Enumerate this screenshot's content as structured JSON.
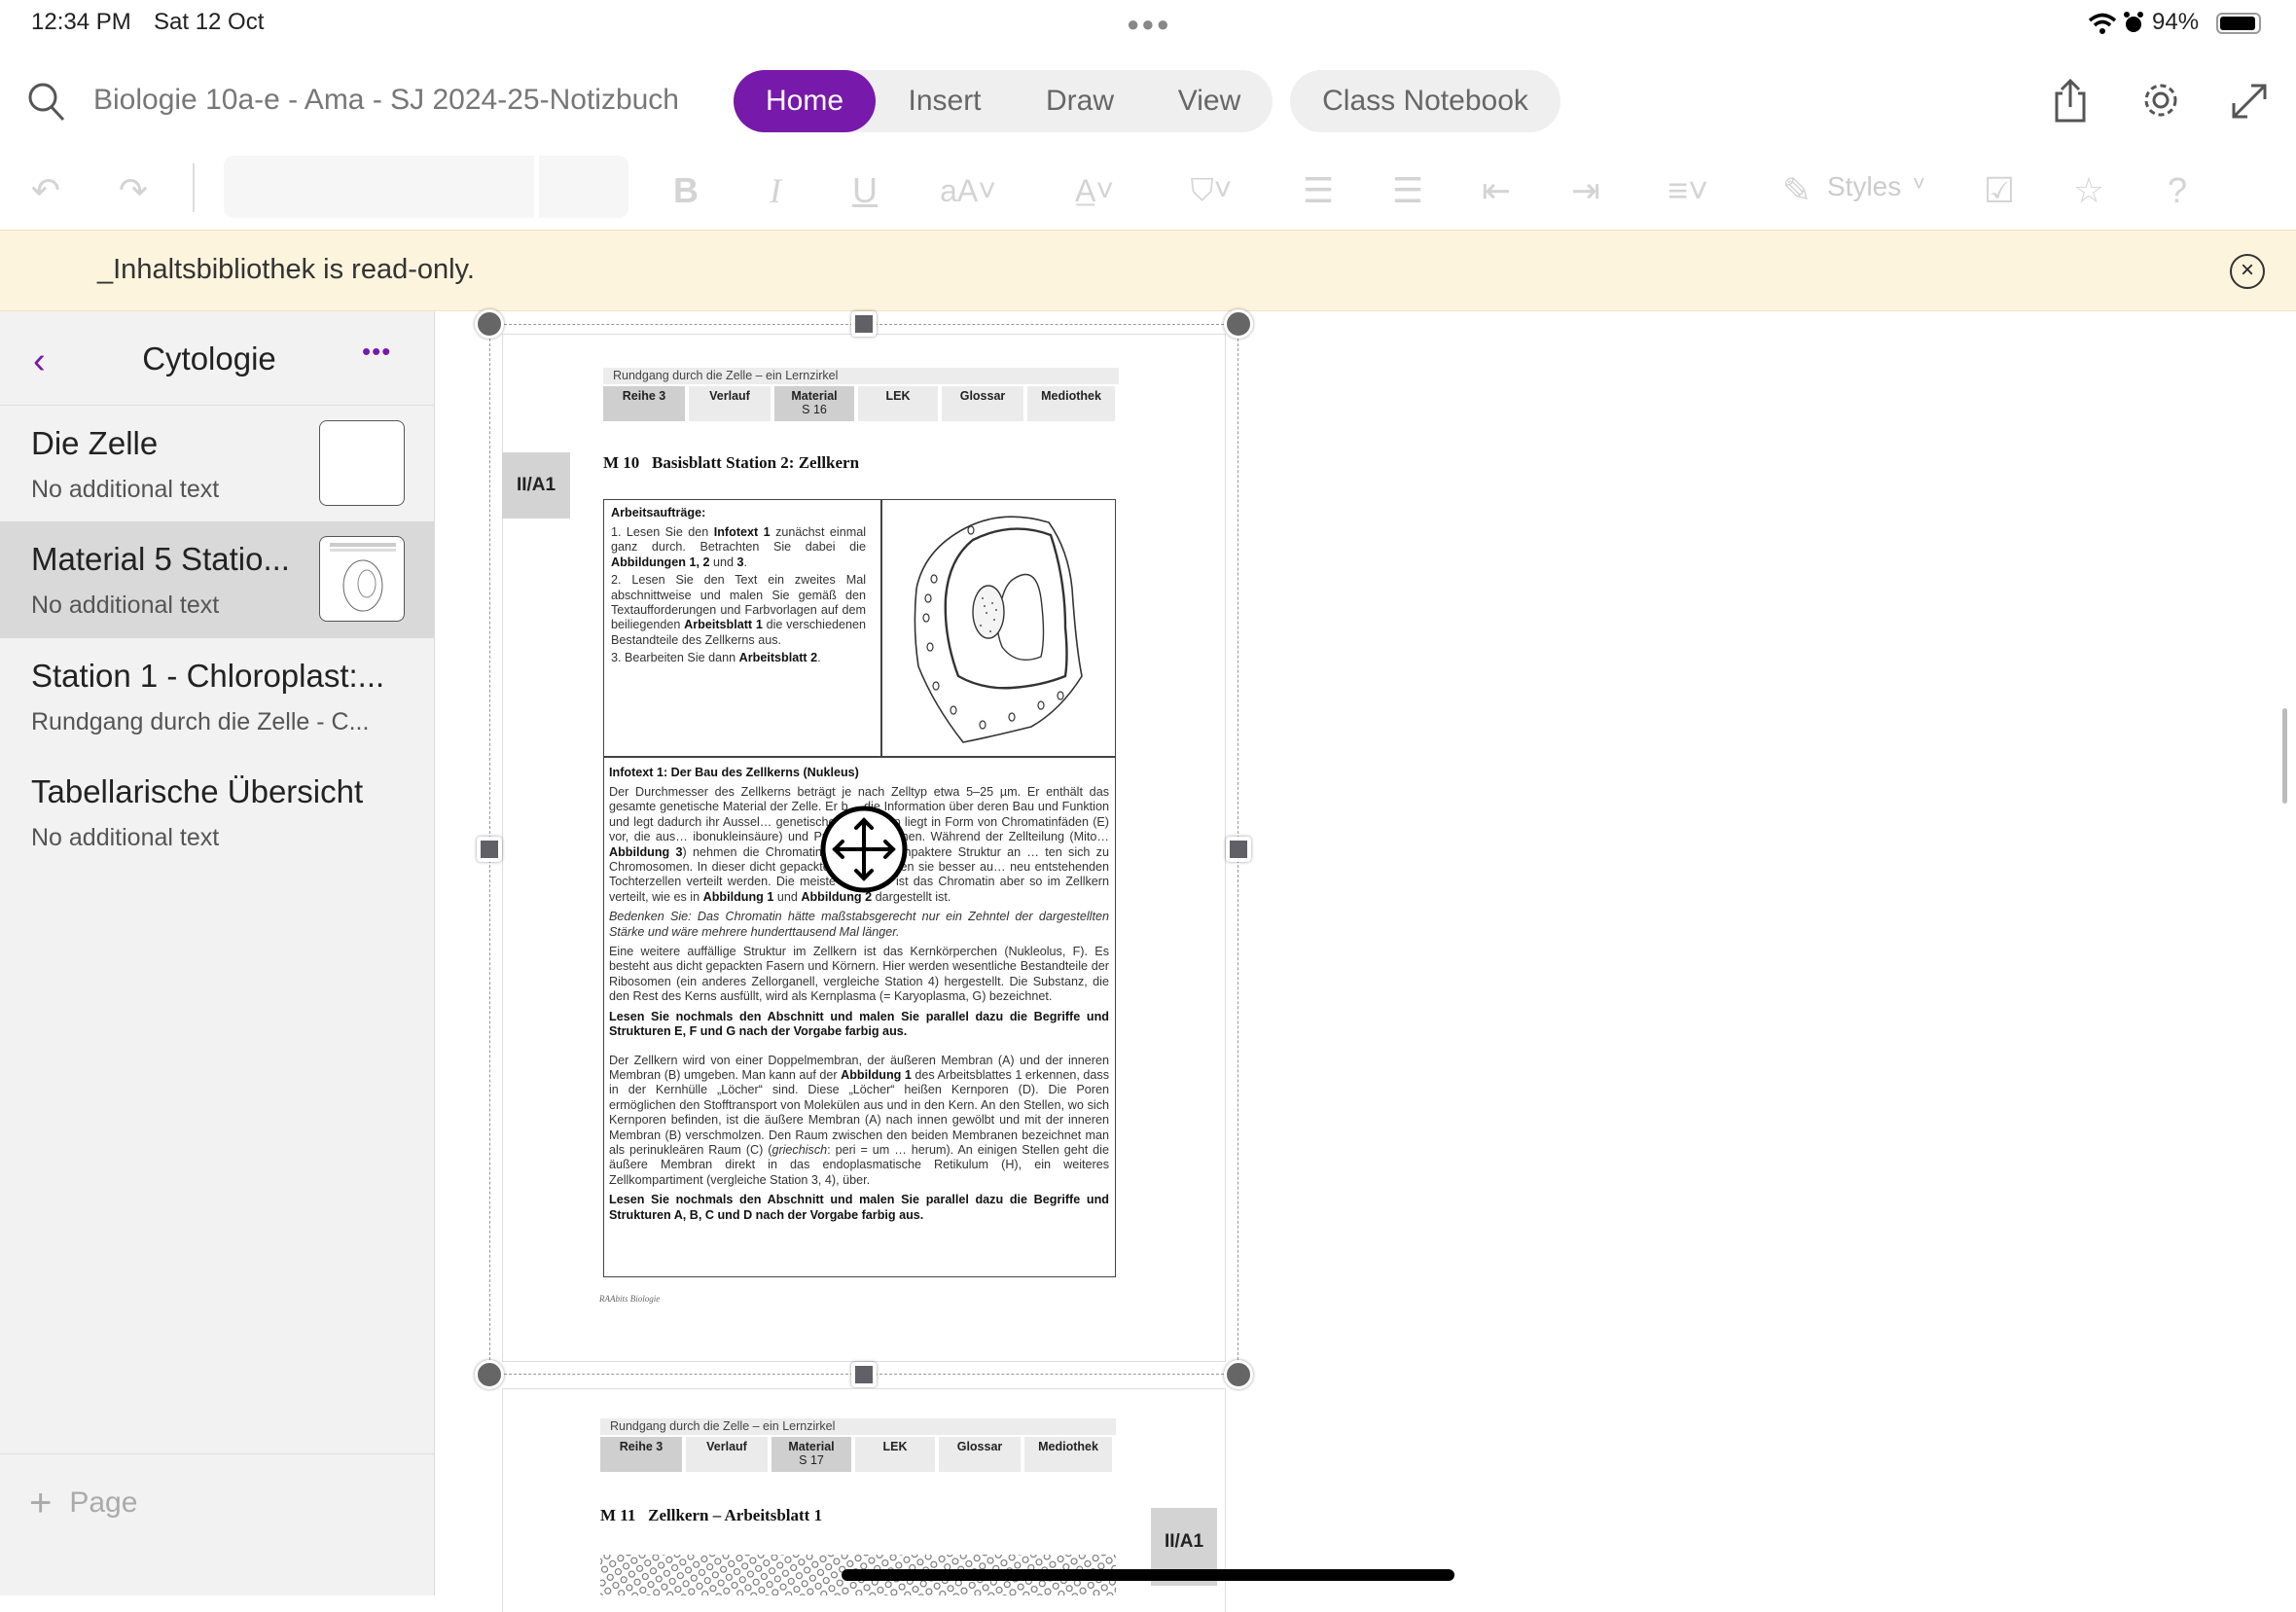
{
  "status_bar": {
    "time": "12:34 PM",
    "date": "Sat 12 Oct",
    "battery": "94%"
  },
  "header": {
    "notebook_title": "Biologie 10a-e - Ama - SJ 2024-25-Notizbuch",
    "tabs": [
      {
        "label": "Home",
        "active": true
      },
      {
        "label": "Insert"
      },
      {
        "label": "Draw"
      },
      {
        "label": "View"
      }
    ],
    "class_notebook": "Class Notebook",
    "accent_color": "#7719aa"
  },
  "toolbar": {
    "styles_label": "Styles"
  },
  "banner": {
    "message": "_Inhaltsbibliothek is read-only."
  },
  "sidebar": {
    "section_title": "Cytologie",
    "pages": [
      {
        "title": "Die Zelle",
        "subtitle": "No additional text"
      },
      {
        "title": "Material 5 Statio...",
        "subtitle": "No additional text",
        "selected": true
      },
      {
        "title": "Station 1 - Chloroplast:...",
        "subtitle": "Rundgang durch die Zelle - C..."
      },
      {
        "title": "Tabellarische Übersicht",
        "subtitle": "No additional text"
      }
    ],
    "add_page": "Page"
  },
  "document": {
    "page1": {
      "header": "Rundgang durch die Zelle – ein Lernzirkel",
      "tabs": [
        {
          "label": "Reihe 3"
        },
        {
          "label": "Verlauf"
        },
        {
          "label": "Material",
          "sub": "S 16"
        },
        {
          "label": "LEK"
        },
        {
          "label": "Glossar"
        },
        {
          "label": "Mediothek"
        }
      ],
      "margin_label": "II/A1",
      "title_num": "M 10",
      "title": "Basisblatt Station 2: Zellkern",
      "tasks_heading": "Arbeitsaufträge:",
      "tasks": [
        [
          {
            "t": "1. Lesen Sie den "
          },
          {
            "t": "Infotext 1",
            "b": true
          },
          {
            "t": " zunächst einmal ganz durch. Betrachten Sie dabei die "
          },
          {
            "t": "Abbildungen 1, 2",
            "b": true
          },
          {
            "t": " und "
          },
          {
            "t": "3",
            "b": true
          },
          {
            "t": "."
          }
        ],
        [
          {
            "t": "2. Lesen Sie den Text ein zweites Mal abschnittweise und malen Sie gemäß den Textaufforderungen und Farbvorlagen auf dem beiliegenden "
          },
          {
            "t": "Arbeitsblatt 1",
            "b": true
          },
          {
            "t": " die verschiedenen Bestandteile des Zellkerns aus."
          }
        ],
        [
          {
            "t": "3. Bearbeiten Sie dann "
          },
          {
            "t": "Arbeitsblatt 2",
            "b": true
          },
          {
            "t": "."
          }
        ]
      ],
      "infotext_heading": "Infotext 1: Der Bau des Zellkerns (Nukleus)",
      "paragraphs": [
        [
          {
            "t": "Der Durchmesser des Zellkerns beträgt je nach Zelltyp etwa 5–25 µm. Er enthält das gesamte genetische Material der Zelle. Er b… die Information über deren Bau und Funktion und legt dadurch ihr Aussel… genetische Information liegt in Form von Chromatinfäden (E) vor, die aus… ibonukleinsäure) und Proteinen bestehen. Während der Zellteilung (Mito… "
          },
          {
            "t": "Abbildung 3",
            "b": true
          },
          {
            "t": ") nehmen die Chromatinfäden eine kompaktere Struktur an … ten sich zu Chromosomen. In dieser dicht gepackten Form können sie besser au… neu entstehenden Tochterzellen verteilt werden. Die meiste Zeit über ist das Chromatin aber so im Zellkern verteilt, wie es in "
          },
          {
            "t": "Abbildung 1",
            "b": true
          },
          {
            "t": " und "
          },
          {
            "t": "Abbildung 2",
            "b": true
          },
          {
            "t": " dargestellt ist."
          }
        ],
        [
          {
            "t": "Bedenken Sie: Das Chromatin hätte maßstabsgerecht nur ein Zehntel der dargestellten Stärke und wäre mehrere hunderttausend Mal länger.",
            "i": true
          }
        ],
        [
          {
            "t": "Eine weitere auffällige Struktur im Zellkern ist das Kernkörperchen (Nukleolus, F). Es besteht aus dicht gepackten Fasern und Körnern. Hier werden wesentliche Bestandteile der Ribosomen (ein anderes Zellorganell, vergleiche Station 4) hergestellt. Die Substanz, die den Rest des Kerns ausfüllt, wird als Kernplasma (= Karyoplasma, G) bezeichnet."
          }
        ],
        [
          {
            "t": "Lesen Sie nochmals den Abschnitt und malen Sie parallel dazu die Begriffe und Strukturen E, F und G nach der Vorgabe farbig aus.",
            "b": true
          }
        ],
        [
          {
            "t": "Der Zellkern wird von einer Doppelmembran, der äußeren Membran (A) und der inneren Membran (B) umgeben. Man kann auf der "
          },
          {
            "t": "Abbildung 1",
            "b": true
          },
          {
            "t": " des Arbeitsblattes 1 erkennen, dass in der Kernhülle „Löcher“ sind. Diese „Löcher“ heißen Kernporen (D). Die Poren ermöglichen den Stofftransport von Molekülen aus und in den Kern. An den Stellen, wo sich Kernporen befinden, ist die äußere Membran (A) nach innen gewölbt und mit der inneren Membran (B) verschmolzen. Den Raum zwischen den beiden Membranen bezeichnet man als perinukleären Raum (C) ("
          },
          {
            "t": "griechisch",
            "i": true
          },
          {
            "t": ": peri = um … herum). An einigen Stellen geht die äußere Membran direkt in das endoplasmatische Retikulum (H), ein weiteres Zellkompartiment (vergleiche Station 3, 4), über."
          }
        ],
        [
          {
            "t": "Lesen Sie nochmals den Abschnitt und malen Sie parallel dazu die Begriffe und Strukturen A, B, C und D nach der Vorgabe farbig aus.",
            "b": true
          }
        ]
      ],
      "footer": "RAAbits Biologie"
    },
    "page2": {
      "header": "Rundgang durch die Zelle – ein Lernzirkel",
      "tabs": [
        {
          "label": "Reihe 3"
        },
        {
          "label": "Verlauf"
        },
        {
          "label": "Material",
          "sub": "S 17"
        },
        {
          "label": "LEK"
        },
        {
          "label": "Glossar"
        },
        {
          "label": "Mediothek"
        }
      ],
      "margin_label": "II/A1",
      "title_num": "M 11",
      "title": "Zellkern – Arbeitsblatt 1"
    }
  }
}
